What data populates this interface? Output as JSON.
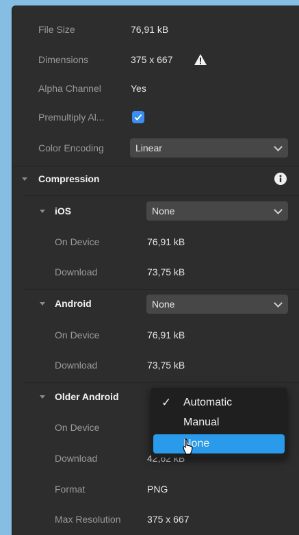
{
  "properties": {
    "file_size_label": "File Size",
    "file_size_value": "76,91 kB",
    "dimensions_label": "Dimensions",
    "dimensions_value": "375 x 667",
    "alpha_label": "Alpha Channel",
    "alpha_value": "Yes",
    "premultiply_label": "Premultiply Al...",
    "premultiply_checked": true,
    "color_encoding_label": "Color Encoding",
    "color_encoding_value": "Linear"
  },
  "compression": {
    "title": "Compression",
    "ios": {
      "title": "iOS",
      "select_value": "None",
      "on_device_label": "On Device",
      "on_device_value": "76,91 kB",
      "download_label": "Download",
      "download_value": "73,75 kB"
    },
    "android": {
      "title": "Android",
      "select_value": "None",
      "on_device_label": "On Device",
      "on_device_value": "76,91 kB",
      "download_label": "Download",
      "download_value": "73,75 kB"
    },
    "older_android": {
      "title": "Older Android",
      "on_device_label": "On Device",
      "download_label": "Download",
      "download_value": "42,62 kB",
      "format_label": "Format",
      "format_value": "PNG",
      "max_res_label": "Max Resolution",
      "max_res_value": "375 x 667"
    }
  },
  "dropdown": {
    "options": [
      "Automatic",
      "Manual",
      "None"
    ],
    "checked": "Automatic",
    "highlighted": "None"
  },
  "colors": {
    "accent": "#2a9aea",
    "panel_bg": "#2d2d2d",
    "desktop_bg": "#85bde3"
  }
}
